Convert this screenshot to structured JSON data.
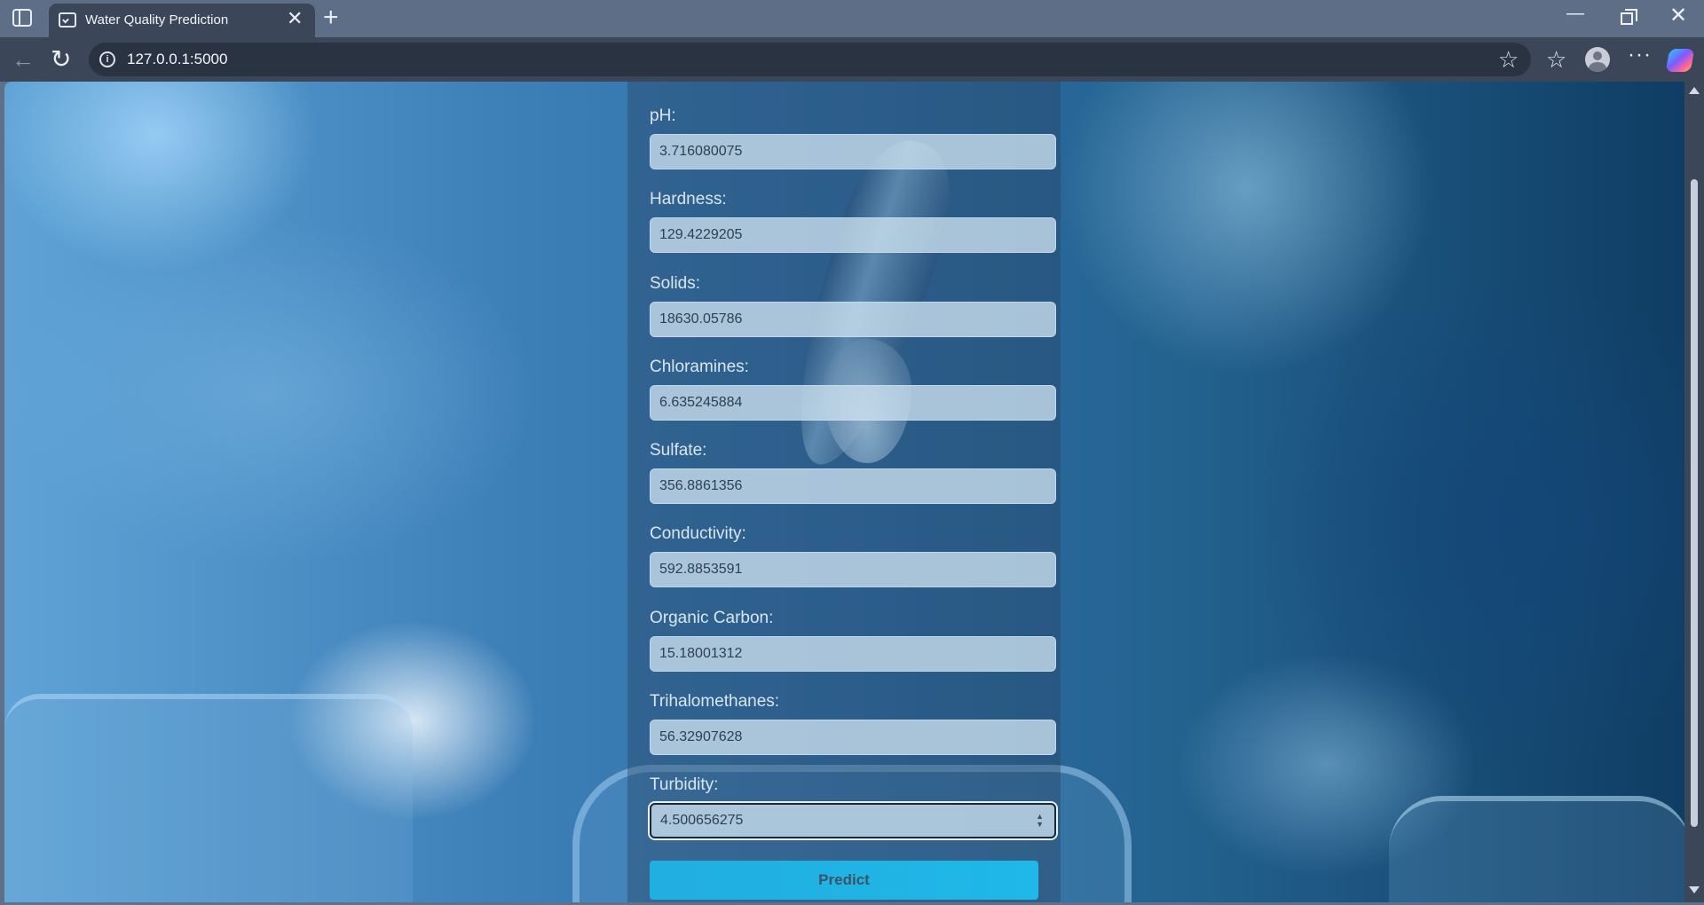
{
  "browser": {
    "tab_title": "Water Quality Prediction",
    "url": "127.0.0.1:5000",
    "new_tab_glyph": "+",
    "close_glyph": "✕",
    "icons": [
      "sidebar-toggle-icon",
      "app-favicon-icon",
      "back-icon",
      "reload-icon",
      "site-info-icon",
      "favorite-star-icon",
      "favorites-icon",
      "profile-icon",
      "more-icon",
      "copilot-icon"
    ]
  },
  "form": {
    "fields": [
      {
        "label": "pH:",
        "value": "3.716080075"
      },
      {
        "label": "Hardness:",
        "value": "129.4229205"
      },
      {
        "label": "Solids:",
        "value": "18630.05786"
      },
      {
        "label": "Chloramines:",
        "value": "6.635245884"
      },
      {
        "label": "Sulfate:",
        "value": "356.8861356"
      },
      {
        "label": "Conductivity:",
        "value": "592.8853591"
      },
      {
        "label": "Organic Carbon:",
        "value": "15.18001312"
      },
      {
        "label": "Trihalomethanes:",
        "value": "56.32907628"
      },
      {
        "label": "Turbidity:",
        "value": "4.500656275"
      }
    ],
    "submit_label": "Predict"
  },
  "colors": {
    "chrome_dark": "#3b4659",
    "chrome_light": "#5d6e86",
    "button": "#21aee0"
  }
}
